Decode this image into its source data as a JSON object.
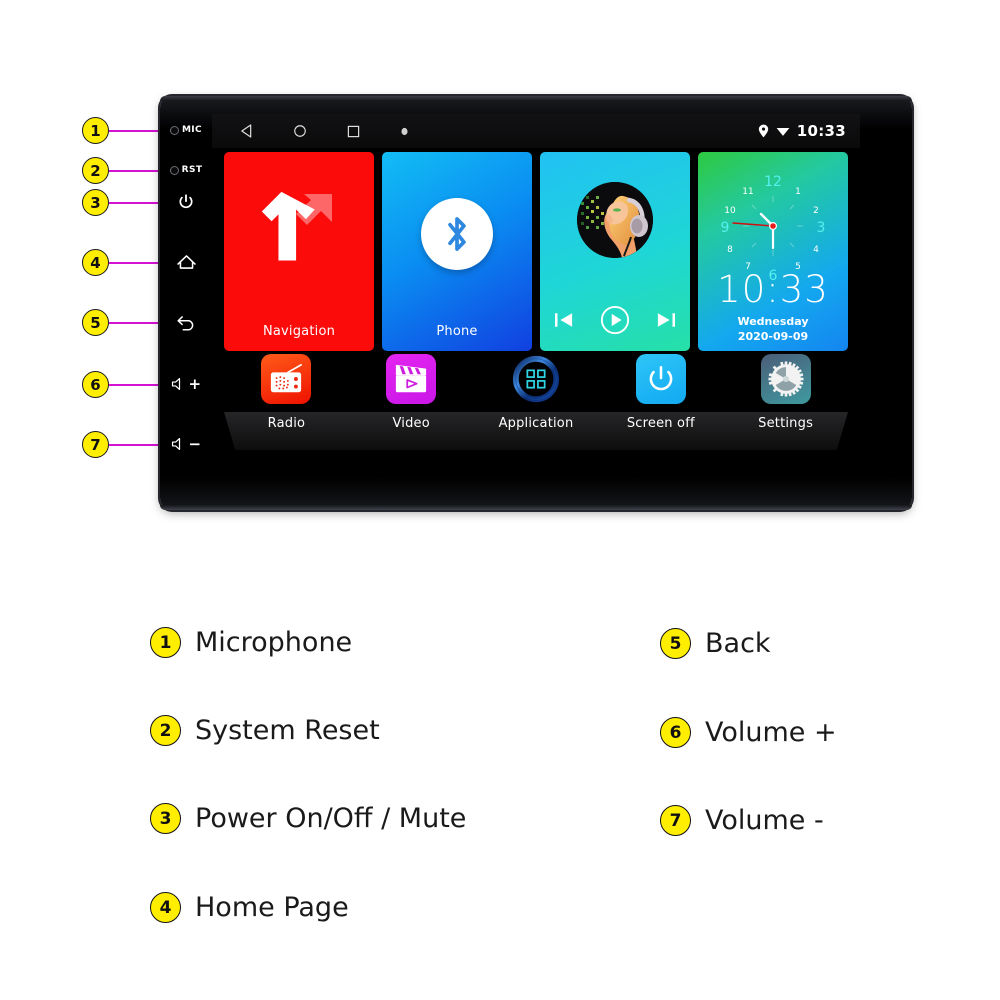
{
  "device": {
    "rail_buttons": [
      {
        "name": "mic",
        "label": "MIC",
        "type": "hole"
      },
      {
        "name": "reset",
        "label": "RST",
        "type": "hole"
      },
      {
        "name": "power",
        "label": "",
        "type": "power-icon"
      },
      {
        "name": "home",
        "label": "",
        "type": "home-icon"
      },
      {
        "name": "back",
        "label": "",
        "type": "back-icon"
      },
      {
        "name": "volume-up",
        "label": "+",
        "type": "speaker-icon"
      },
      {
        "name": "volume-down",
        "label": "−",
        "type": "speaker-icon"
      }
    ]
  },
  "screen": {
    "statusbar": {
      "nav_keys": [
        "back-triangle-icon",
        "home-circle-icon",
        "recents-square-icon",
        "dot-icon"
      ],
      "location_icon": "location-pin-icon",
      "wifi_icon": "wifi-icon",
      "clock": "10:33"
    },
    "widgets": [
      {
        "id": "navigation",
        "label": "Navigation",
        "icon": "road-fork-arrow-icon",
        "color": "#fc0b0b"
      },
      {
        "id": "phone",
        "label": "Phone",
        "icon": "bluetooth-icon",
        "color": "#0a8ef2"
      },
      {
        "id": "music",
        "label": "",
        "icon": "album-art-icon",
        "controls": [
          "prev-track-icon",
          "play-icon",
          "next-track-icon"
        ],
        "color": "#1fd6d6"
      },
      {
        "id": "clock",
        "label": "",
        "time": "10:33",
        "weekday": "Wednesday",
        "date": "2020-09-09",
        "color": "#13a8ef"
      }
    ],
    "dock": [
      {
        "id": "radio",
        "label": "Radio",
        "icon": "radio-icon",
        "color": "#ef1100"
      },
      {
        "id": "video",
        "label": "Video",
        "icon": "clapperboard-play-icon",
        "color": "#c916e8"
      },
      {
        "id": "application",
        "label": "Application",
        "icon": "grid-apps-icon",
        "color": "#0b3a7a"
      },
      {
        "id": "screen-off",
        "label": "Screen off",
        "icon": "power-icon",
        "color": "#12a9f2"
      },
      {
        "id": "settings",
        "label": "Settings",
        "icon": "gear-icon",
        "color": "#3f9aa0"
      }
    ]
  },
  "callouts": [
    {
      "n": "1"
    },
    {
      "n": "2"
    },
    {
      "n": "3"
    },
    {
      "n": "4"
    },
    {
      "n": "5"
    },
    {
      "n": "6"
    },
    {
      "n": "7"
    }
  ],
  "legend": {
    "left": [
      {
        "n": "1",
        "text": "Microphone"
      },
      {
        "n": "2",
        "text": "System Reset"
      },
      {
        "n": "3",
        "text": "Power On/Off / Mute"
      },
      {
        "n": "4",
        "text": "Home Page"
      }
    ],
    "right": [
      {
        "n": "5",
        "text": "Back"
      },
      {
        "n": "6",
        "text": "Volume +"
      },
      {
        "n": "7",
        "text": "Volume -"
      }
    ]
  },
  "colors": {
    "badge": "#ffee00",
    "leader": "#d412d4",
    "bezel": "#000000"
  }
}
